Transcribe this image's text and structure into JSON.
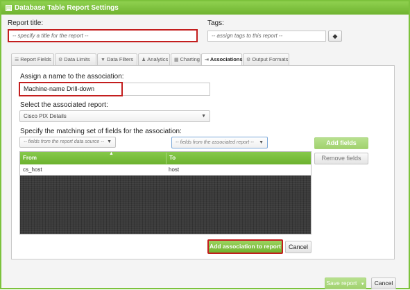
{
  "window": {
    "title": "Database Table Report Settings"
  },
  "report_title": {
    "label": "Report title:",
    "placeholder": "-- specify a title for the report --"
  },
  "tags": {
    "label": "Tags:",
    "placeholder": "-- assign tags to this report --",
    "icon": "tag-icon"
  },
  "tabs": [
    {
      "label": "Report Fields",
      "icon": "list-icon",
      "glyph": "☰"
    },
    {
      "label": "Data Limits",
      "icon": "gear-icon",
      "glyph": "⚙"
    },
    {
      "label": "Data Filters",
      "icon": "filter-icon",
      "glyph": "▼"
    },
    {
      "label": "Analytics",
      "icon": "person-icon",
      "glyph": "♟"
    },
    {
      "label": "Charting",
      "icon": "chart-icon",
      "glyph": "▦"
    },
    {
      "label": "Associations",
      "icon": "link-icon",
      "glyph": "⇥",
      "active": true
    },
    {
      "label": "Output Formats",
      "icon": "settings-icon",
      "glyph": "⚙"
    }
  ],
  "association": {
    "name_label": "Assign a name to the association:",
    "name_value": "Machine-name Drill-down",
    "report_label": "Select the associated report:",
    "report_value": "Cisco PIX Details",
    "fields_label": "Specify the matching set of fields for the association:",
    "source_placeholder": "-- fields from the report data source --",
    "assoc_placeholder": "-- fields from the associated report --",
    "add_fields": "Add fields",
    "remove_fields": "Remove fields"
  },
  "grid": {
    "columns": [
      "From",
      "To"
    ],
    "rows": [
      {
        "from": "cs_host",
        "to": "host"
      }
    ]
  },
  "actions": {
    "add_association": "Add association to report",
    "cancel": "Cancel"
  },
  "footer": {
    "save": "Save report",
    "cancel": "Cancel"
  },
  "colors": {
    "accent": "#7cc23c",
    "highlight": "#c31e1e"
  }
}
